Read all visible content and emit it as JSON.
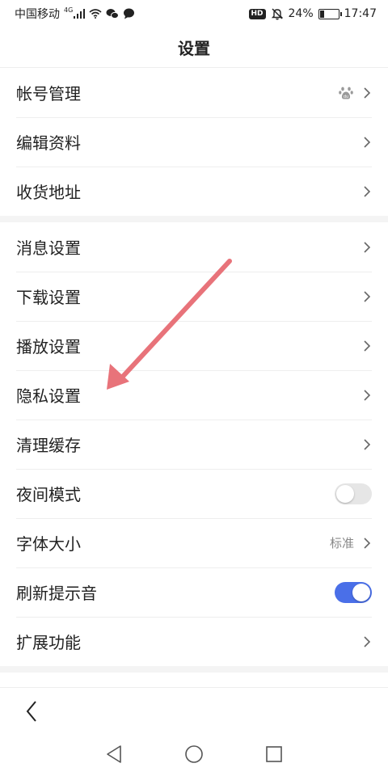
{
  "status_bar": {
    "carrier": "中国移动",
    "network": "4G",
    "hd": "HD",
    "battery_percent": "24%",
    "battery_level": 0.24,
    "time": "17:47",
    "icons": [
      "signal-icon",
      "wifi-icon",
      "wechat-icon",
      "message-icon",
      "mute-icon",
      "battery-icon"
    ]
  },
  "header": {
    "title": "设置"
  },
  "groups": [
    {
      "items": [
        {
          "label": "帐号管理",
          "right_icon": "baidu-paw-icon"
        },
        {
          "label": "编辑资料"
        },
        {
          "label": "收货地址"
        }
      ]
    },
    {
      "items": [
        {
          "label": "消息设置"
        },
        {
          "label": "下载设置"
        },
        {
          "label": "播放设置"
        },
        {
          "label": "隐私设置"
        },
        {
          "label": "清理缓存"
        },
        {
          "label": "夜间模式",
          "toggle": false
        },
        {
          "label": "字体大小",
          "value": "标准"
        },
        {
          "label": "刷新提示音",
          "toggle": true
        },
        {
          "label": "扩展功能"
        }
      ]
    }
  ],
  "colors": {
    "toggle_on": "#4a6fe8",
    "toggle_off": "#e6e6e6",
    "annotation_arrow": "#e8737a",
    "separator": "#f4f4f4"
  },
  "annotation": {
    "points_to": "隐私设置"
  },
  "bottom_bar": {
    "icons": [
      "back-arrow-icon"
    ]
  },
  "system_nav": {
    "icons": [
      "nav-back-icon",
      "nav-home-icon",
      "nav-recents-icon"
    ]
  }
}
